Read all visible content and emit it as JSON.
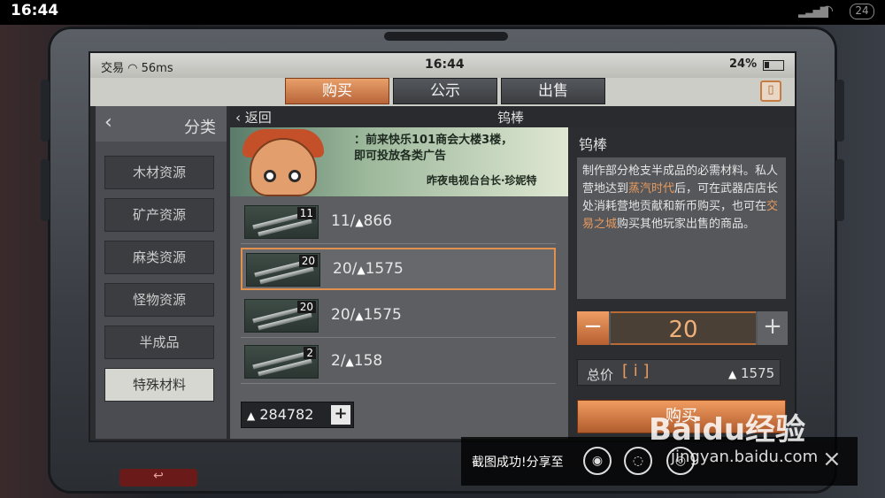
{
  "system": {
    "time": "16:44",
    "battery": "24"
  },
  "inner_status": {
    "app": "交易",
    "ping": "56ms",
    "time": "16:44",
    "battery": "24%"
  },
  "tabs": [
    {
      "label": "购买"
    },
    {
      "label": "公示"
    },
    {
      "label": "出售"
    }
  ],
  "category": {
    "title": "分类",
    "items": [
      {
        "label": "木材资源"
      },
      {
        "label": "矿产资源"
      },
      {
        "label": "麻类资源"
      },
      {
        "label": "怪物资源"
      },
      {
        "label": "半成品"
      },
      {
        "label": "特殊材料"
      }
    ]
  },
  "header": {
    "back": "返回",
    "title": "钨棒"
  },
  "banner": {
    "line1": "：前来快乐101商会大楼3楼，",
    "line2": "即可投放各类广告",
    "signature": "昨夜电视台台长·珍妮特"
  },
  "listings": [
    {
      "qty": "11",
      "price": "11/",
      "total": "866"
    },
    {
      "qty": "20",
      "price": "20/",
      "total": "1575"
    },
    {
      "qty": "20",
      "price": "20/",
      "total": "1575"
    },
    {
      "qty": "2",
      "price": "2/",
      "total": "158"
    }
  ],
  "funds": "284782",
  "detail": {
    "name": "钨棒",
    "desc_a": "制作部分枪支半成品的必需材料。私人营地达到",
    "desc_hl1": "蒸汽时代",
    "desc_b": "后，可在武器店店长处消耗营地贡献和新币购买，也可在",
    "desc_hl2": "交易之城",
    "desc_c": "购买其他玩家出售的商品。"
  },
  "quantity": "20",
  "total": {
    "label": "总价",
    "value": "1575"
  },
  "buy_label": "购买",
  "toast": {
    "text": "截图成功!分享至"
  },
  "watermark": {
    "logo": "Baidu经验",
    "url": "jingyan.baidu.com"
  },
  "colors": {
    "accent": "#e2904e",
    "panel": "#5c5e62"
  }
}
